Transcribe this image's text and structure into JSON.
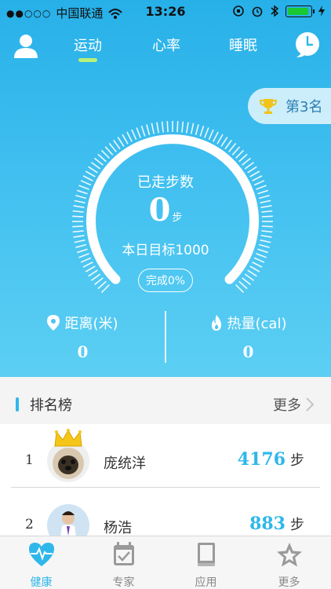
{
  "status_bar": {
    "carrier": "中国联通",
    "time": "13:26"
  },
  "nav": {
    "tabs": [
      {
        "label": "运动"
      },
      {
        "label": "心率"
      },
      {
        "label": "睡眠"
      }
    ],
    "active_tab_index": 0
  },
  "rank_badge": {
    "label": "第3名"
  },
  "gauge": {
    "title": "已走步数",
    "steps": "0",
    "steps_unit": "步",
    "goal": "本日目标1000",
    "complete": "完成0%",
    "progress": 0
  },
  "stats": {
    "distance": {
      "label": "距离(米)",
      "value": "0"
    },
    "calories": {
      "label": "热量(cal)",
      "value": "0"
    }
  },
  "ranking": {
    "title": "排名榜",
    "more": "更多",
    "rows": [
      {
        "rank": "1",
        "name": "庞统洋",
        "steps": "4176",
        "unit": "步"
      },
      {
        "rank": "2",
        "name": "杨浩",
        "steps": "883",
        "unit": "步"
      }
    ]
  },
  "tabbar": {
    "items": [
      {
        "label": "健康",
        "icon": "heart-pulse-icon"
      },
      {
        "label": "专家",
        "icon": "calendar-check-icon"
      },
      {
        "label": "应用",
        "icon": "book-icon"
      },
      {
        "label": "更多",
        "icon": "star-icon"
      }
    ],
    "active_index": 0
  },
  "colors": {
    "accent": "#2fb7ea",
    "hero_top": "#27b0e8",
    "hero_bottom": "#5ccff3",
    "nav_underline": "#b7f07a"
  }
}
